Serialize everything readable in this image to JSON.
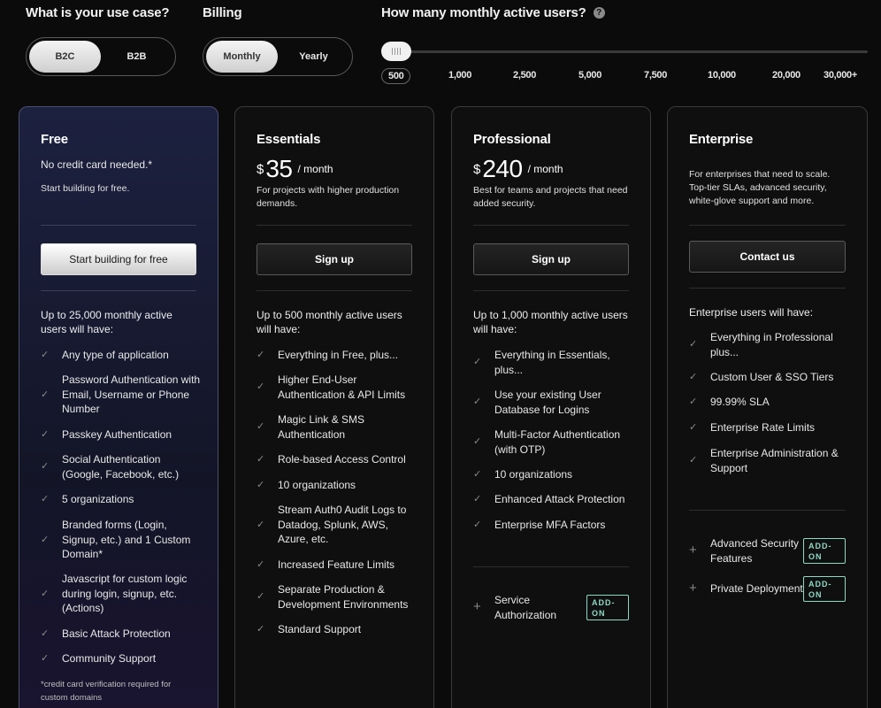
{
  "use_case": {
    "label": "What is your use case?",
    "options": [
      "B2C",
      "B2B"
    ]
  },
  "billing": {
    "label": "Billing",
    "options": [
      "Monthly",
      "Yearly"
    ]
  },
  "mau": {
    "label": "How many monthly active users?",
    "help": "?",
    "ticks": [
      "500",
      "1,000",
      "2,500",
      "5,000",
      "7,500",
      "10,000",
      "20,000",
      "30,000+"
    ],
    "selected": "500"
  },
  "free": {
    "name": "Free",
    "subtitle": "No credit card needed.*",
    "desc": "Start building for free.",
    "cta": "Start building for free",
    "intro": "Up to 25,000 monthly active users will have:",
    "features": [
      "Any type of application",
      "Password Authentication with Email, Username or Phone Number",
      "Passkey Authentication",
      "Social Authentication (Google, Facebook, etc.)",
      "5 organizations",
      "Branded forms (Login, Signup, etc.) and 1 Custom Domain*",
      "Javascript for custom logic during login, signup, etc. (Actions)",
      "Basic Attack Protection",
      "Community Support"
    ],
    "footnote": "*credit card verification required for custom domains"
  },
  "essentials": {
    "name": "Essentials",
    "currency": "$",
    "price": "35",
    "period": "/ month",
    "desc": "For projects with higher production demands.",
    "cta": "Sign up",
    "intro": "Up to 500 monthly active users will have:",
    "features": [
      "Everything in Free, plus...",
      "Higher End-User Authentication & API Limits",
      "Magic Link & SMS Authentication",
      "Role-based Access Control",
      "10 organizations",
      "Stream Auth0 Audit Logs to Datadog, Splunk, AWS, Azure, etc.",
      "Increased Feature Limits",
      "Separate Production & Development Environments",
      "Standard Support"
    ]
  },
  "professional": {
    "name": "Professional",
    "currency": "$",
    "price": "240",
    "period": "/ month",
    "desc": "Best for teams and projects that need added security.",
    "cta": "Sign up",
    "intro": "Up to 1,000 monthly active users will have:",
    "features": [
      "Everything in Essentials, plus...",
      "Use your existing User Database for Logins",
      "Multi-Factor Authentication (with OTP)",
      "10 organizations",
      "Enhanced Attack Protection",
      "Enterprise MFA Factors"
    ],
    "addons": [
      {
        "label": "Service Authorization",
        "badge": "ADD-ON"
      }
    ]
  },
  "enterprise": {
    "name": "Enterprise",
    "desc": "For enterprises that need to scale. Top-tier SLAs, advanced security, white-glove support and more.",
    "cta": "Contact us",
    "intro": "Enterprise users will have:",
    "features": [
      "Everything in Professional plus...",
      "Custom User & SSO Tiers",
      "99.99% SLA",
      "Enterprise Rate Limits",
      "Enterprise Administration & Support"
    ],
    "addons": [
      {
        "label": "Advanced Security Features",
        "badge": "ADD-ON"
      },
      {
        "label": "Private Deployment",
        "badge": "ADD-ON"
      }
    ]
  },
  "colors": {
    "background": "#0b0b0b",
    "addon_accent": "#8fd8c4",
    "free_card": "#1c2140"
  }
}
